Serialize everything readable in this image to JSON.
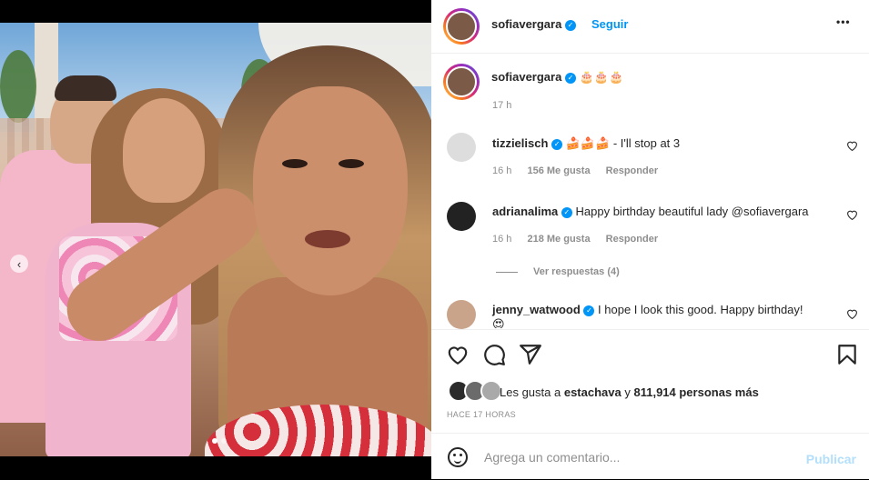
{
  "post": {
    "author": "sofiavergara",
    "follow_label": "Seguir",
    "more_label": "•••",
    "caption_emoji": "🎂🎂🎂",
    "caption_time": "17 h"
  },
  "comments": [
    {
      "username": "tizzielisch",
      "text": "🍰🍰🍰 - I'll stop at 3",
      "time": "16 h",
      "likes": "156 Me gusta",
      "reply": "Responder"
    },
    {
      "username": "adrianalima",
      "text": "Happy birthday beautiful lady @sofiavergara",
      "time": "16 h",
      "likes": "218 Me gusta",
      "reply": "Responder",
      "view_replies": "Ver respuestas (4)"
    },
    {
      "username": "jenny_watwood",
      "text": "I hope I look this good. Happy birthday!",
      "extra": "😍"
    }
  ],
  "likes": {
    "prefix": "Les gusta a",
    "user": "estachava",
    "connector": "y",
    "count": "811,914 personas más"
  },
  "posted_ago": "HACE 17 HORAS",
  "comment_box": {
    "placeholder": "Agrega un comentario...",
    "publish_label": "Publicar"
  },
  "colors": {
    "accent": "#0095f6",
    "text": "#262626",
    "muted": "#8e8e8e",
    "publish_disabled": "#b2dffc"
  },
  "icons": {
    "like": "heart-icon",
    "comment": "comment-icon",
    "share": "share-icon",
    "save": "bookmark-icon",
    "emoji": "emoji-icon",
    "verified": "verified-icon"
  }
}
